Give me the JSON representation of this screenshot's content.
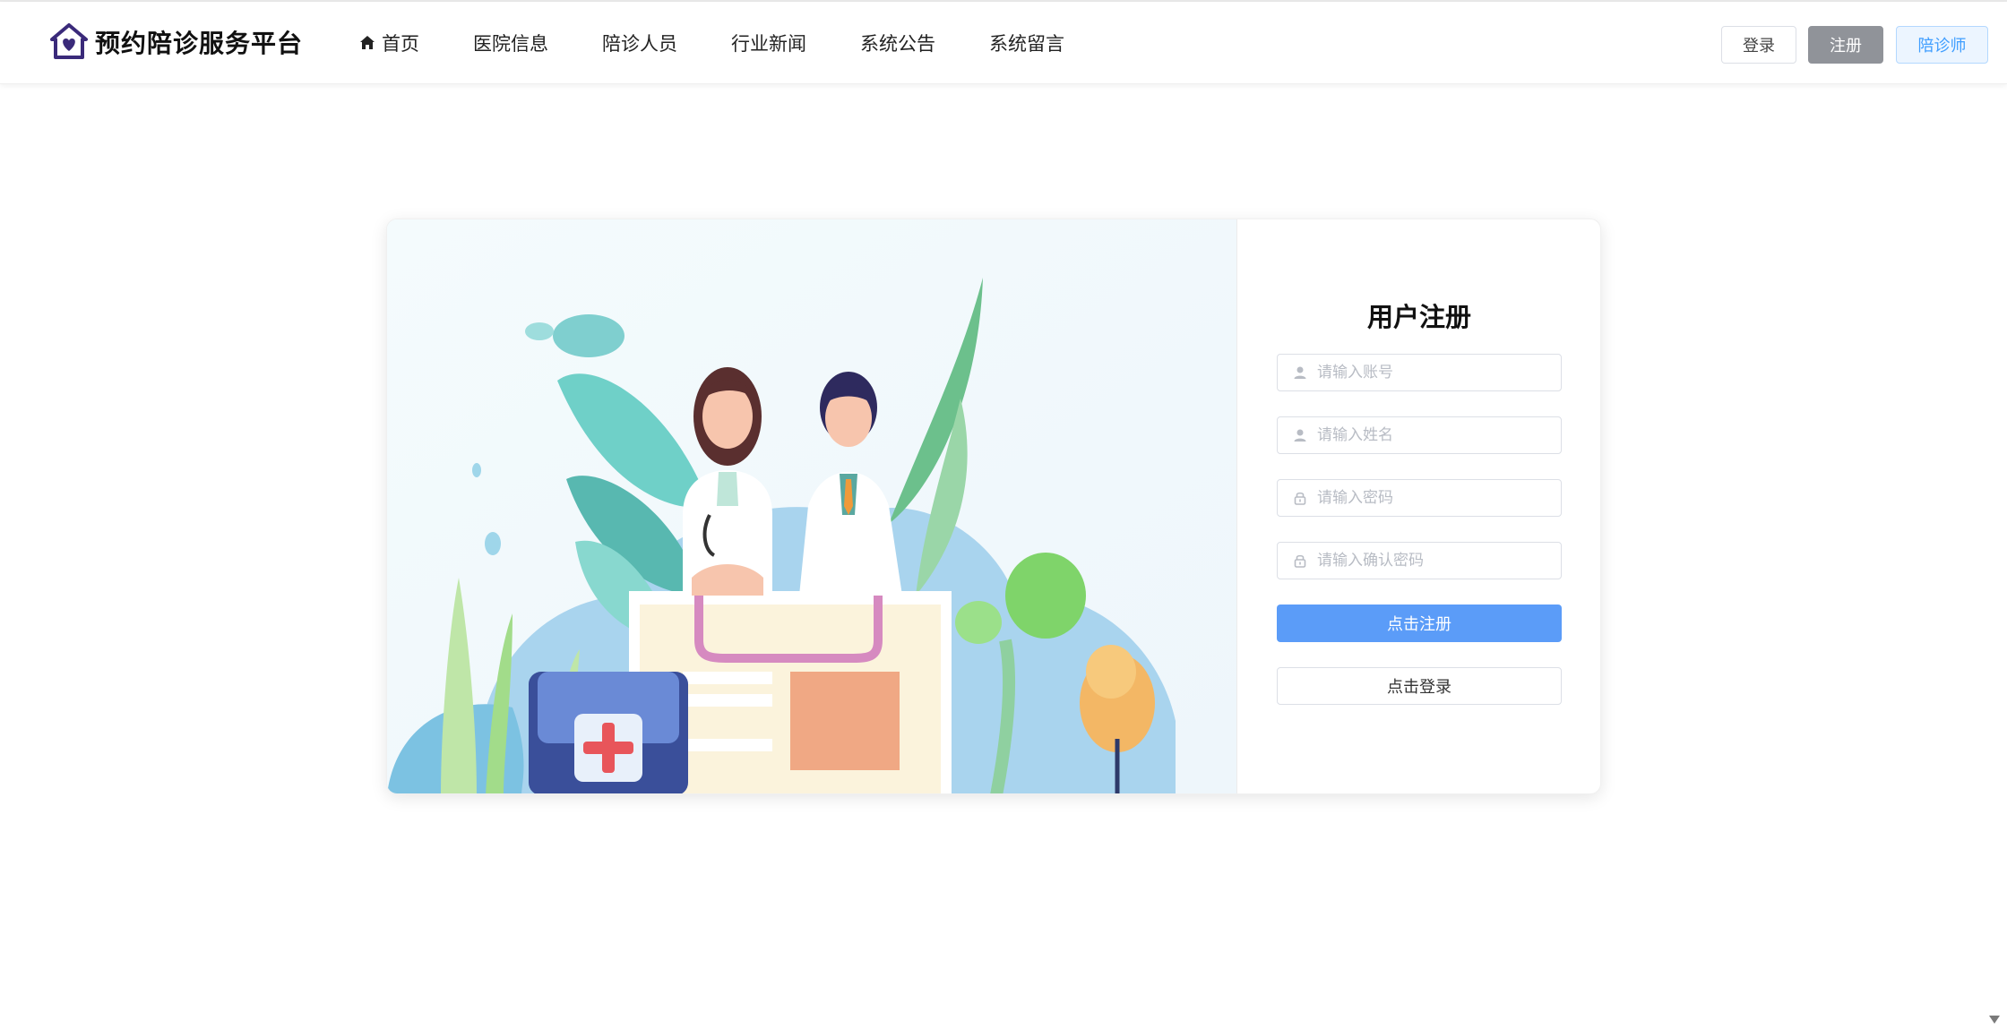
{
  "header": {
    "logo_text": "预约陪诊服务平台",
    "nav": [
      {
        "label": "首页",
        "icon": "home-icon"
      },
      {
        "label": "医院信息"
      },
      {
        "label": "陪诊人员"
      },
      {
        "label": "行业新闻"
      },
      {
        "label": "系统公告"
      },
      {
        "label": "系统留言"
      }
    ],
    "buttons": {
      "login": "登录",
      "register": "注册",
      "escort": "陪诊师"
    }
  },
  "form": {
    "title": "用户注册",
    "fields": {
      "account": {
        "placeholder": "请输入账号",
        "icon": "user-icon"
      },
      "name": {
        "placeholder": "请输入姓名",
        "icon": "user-icon"
      },
      "password": {
        "placeholder": "请输入密码",
        "icon": "lock-icon"
      },
      "confirm": {
        "placeholder": "请输入确认密码",
        "icon": "lock-icon"
      }
    },
    "submit_label": "点击注册",
    "login_label": "点击登录"
  },
  "colors": {
    "primary": "#5b9cf8",
    "register_btn": "#909399",
    "escort_btn_bg": "#ecf5ff",
    "escort_btn_text": "#409eff",
    "logo_purple": "#3a2a7a"
  }
}
